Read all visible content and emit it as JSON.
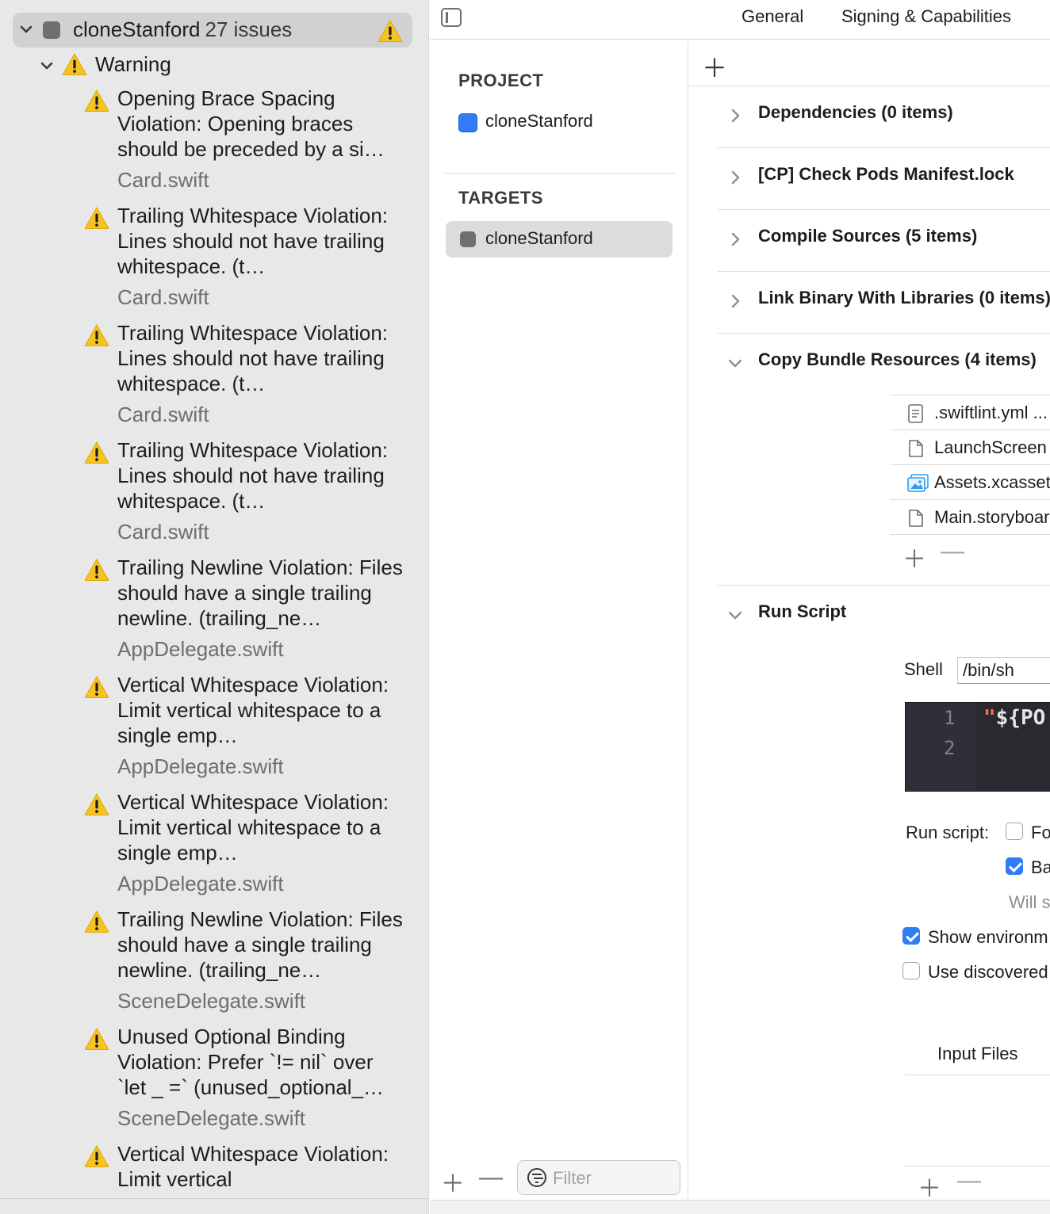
{
  "issue_navigator": {
    "project_name": "cloneStanford",
    "issue_count": "27 issues",
    "group_label": "Warning",
    "issues": [
      {
        "message": "Opening Brace Spacing Violation: Opening braces should be preceded by a si…",
        "file": "Card.swift"
      },
      {
        "message": "Trailing Whitespace Violation: Lines should not have trailing whitespace. (t…",
        "file": "Card.swift"
      },
      {
        "message": "Trailing Whitespace Violation: Lines should not have trailing whitespace. (t…",
        "file": "Card.swift"
      },
      {
        "message": "Trailing Whitespace Violation: Lines should not have trailing whitespace. (t…",
        "file": "Card.swift"
      },
      {
        "message": "Trailing Newline Violation: Files should have a single trailing newline. (trailing_ne…",
        "file": "AppDelegate.swift"
      },
      {
        "message": "Vertical Whitespace Violation: Limit vertical whitespace to a single emp…",
        "file": "AppDelegate.swift"
      },
      {
        "message": "Vertical Whitespace Violation: Limit vertical whitespace to a single emp…",
        "file": "AppDelegate.swift"
      },
      {
        "message": "Trailing Newline Violation: Files should have a single trailing newline. (trailing_ne…",
        "file": "SceneDelegate.swift"
      },
      {
        "message": "Unused Optional Binding Violation: Prefer `!= nil` over `let _ =` (unused_optional_…",
        "file": "SceneDelegate.swift"
      },
      {
        "message": "Vertical Whitespace Violation: Limit vertical",
        "file": ""
      }
    ]
  },
  "editor_tabs": [
    "General",
    "Signing & Capabilities"
  ],
  "project_list": {
    "project_header": "PROJECT",
    "project_item": "cloneStanford",
    "targets_header": "TARGETS",
    "target_item": "cloneStanford",
    "filter_placeholder": "Filter"
  },
  "build_phases": {
    "phases": [
      {
        "title": "Dependencies (0 items)",
        "expanded": false
      },
      {
        "title": "[CP] Check Pods Manifest.lock",
        "expanded": false
      },
      {
        "title": "Compile Sources (5 items)",
        "expanded": false
      },
      {
        "title": "Link Binary With Libraries (0 items)",
        "expanded": false
      },
      {
        "title": "Copy Bundle Resources (4 items)",
        "expanded": true
      }
    ],
    "resources": [
      {
        "name": ".swiftlint.yml  ...",
        "icon": "text-file-icon"
      },
      {
        "name": "LaunchScreen",
        "icon": "document-icon"
      },
      {
        "name": "Assets.xcassets",
        "icon": "asset-catalog-icon"
      },
      {
        "name": "Main.storyboard",
        "icon": "document-icon"
      }
    ],
    "run_script": {
      "title": "Run Script",
      "shell_label": "Shell",
      "shell_value": "/bin/sh",
      "line_numbers": [
        "1",
        "2"
      ],
      "code_quote": "\"",
      "code_text": "${PO",
      "run_script_label": "Run script:",
      "option_1": "Fo",
      "option_1_checked": false,
      "option_2": "Ba",
      "option_2_checked": true,
      "option_hint": "Will s",
      "show_env": "Show environm",
      "show_env_checked": true,
      "use_discovered": "Use discovered",
      "use_discovered_checked": false,
      "input_files_label": "Input Files"
    }
  },
  "colors": {
    "warning": "#f5c322",
    "accent": "#2f7cf6",
    "sidebar_bg": "#e8e8e8"
  }
}
